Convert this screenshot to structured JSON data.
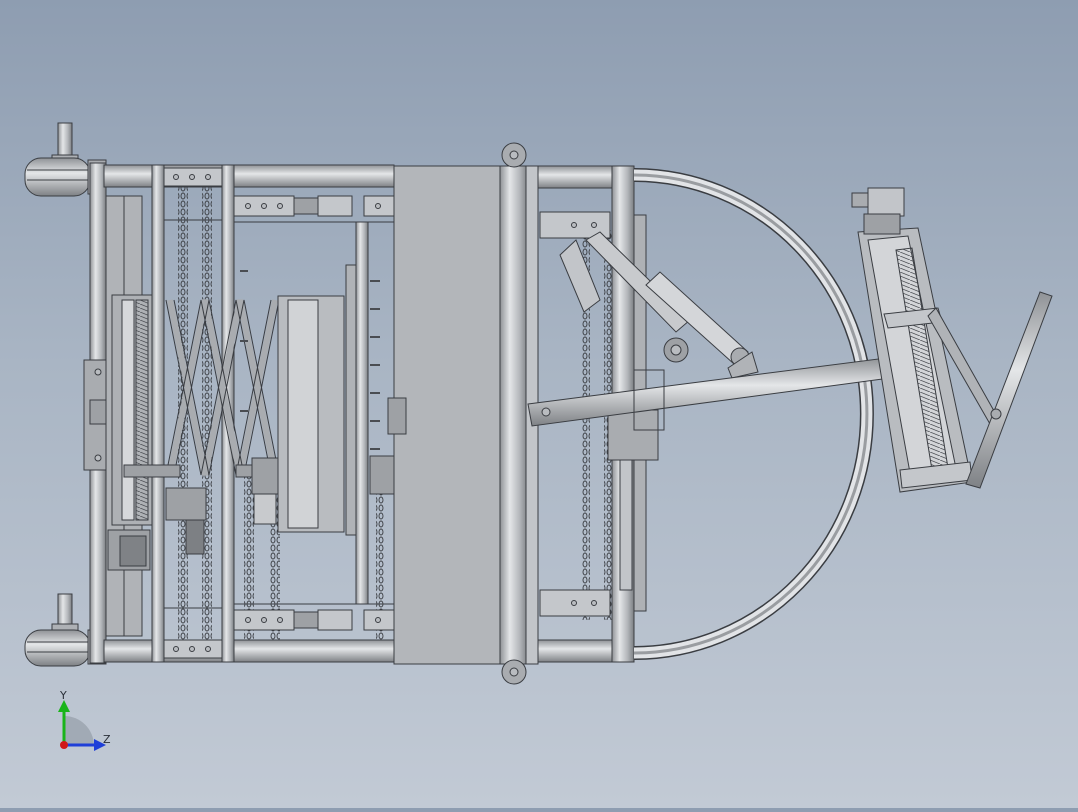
{
  "viewport": {
    "background_top": "#8e9db1",
    "background_bottom": "#c2cad5",
    "part_color": "#b9bcc0",
    "edge_color": "#3a3d42"
  },
  "triad": {
    "y_label": "Y",
    "z_label": "Z",
    "y_color": "#19b419",
    "z_color": "#1f3fd8",
    "x_color": "#d01818"
  }
}
